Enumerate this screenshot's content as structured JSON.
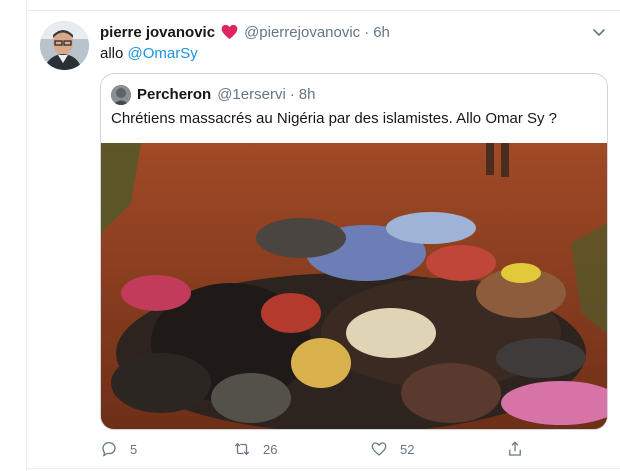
{
  "tweet": {
    "author_name": "pierre jovanovic",
    "author_handle": "@pierrejovanovic",
    "separator": "·",
    "time": "6h",
    "text_prefix": "allo",
    "mention": "@OmarSy"
  },
  "quoted_tweet": {
    "author_name": "Percheron",
    "author_handle": "@1erservi",
    "separator": "·",
    "time": "8h",
    "text": "Chrétiens massacrés au Nigéria par des islamistes. Allo Omar Sy ?"
  },
  "actions": {
    "reply_count": "5",
    "retweet_count": "26",
    "like_count": "52"
  },
  "colors": {
    "link": "#1b95e0",
    "muted": "#657786",
    "heart": "#e0245e",
    "border": "#ccd6dd"
  },
  "icons": [
    "heart-icon",
    "chevron-down-icon",
    "reply-icon",
    "retweet-icon",
    "like-icon",
    "share-icon"
  ]
}
